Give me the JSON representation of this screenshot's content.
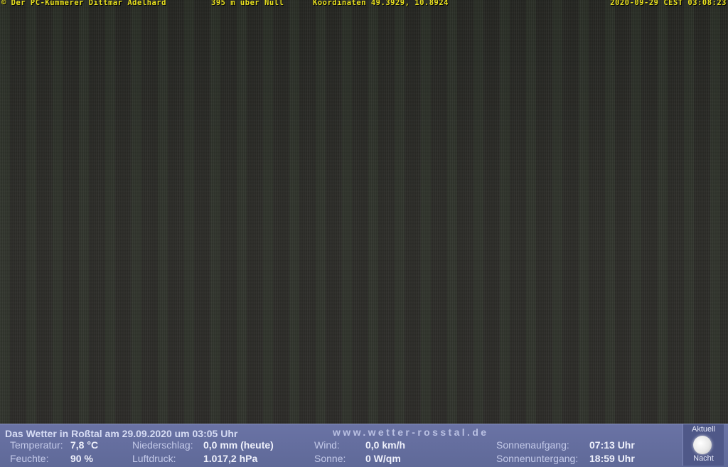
{
  "camera": {
    "copyright": "© Der PC-Kümmerer Dittmar Adelhard",
    "altitude": "395 m über Null",
    "coordinates": "Koordinaten 49.3929, 10.8924",
    "timestamp": "2020-09-29 CEST 03:08:23"
  },
  "weather": {
    "headline": "Das Wetter in Roßtal am 29.09.2020 um 03:05 Uhr",
    "website": "www.wetter-rosstal.de",
    "temperature_label": "Temperatur:",
    "temperature_value": "7,8 °C",
    "humidity_label": "Feuchte:",
    "humidity_value": "90 %",
    "precip_label": "Niederschlag:",
    "precip_value": "0,0 mm (heute)",
    "pressure_label": "Luftdruck:",
    "pressure_value": "1.017,2 hPa",
    "wind_label": "Wind:",
    "wind_value": "0,0 km/h",
    "sun_label": "Sonne:",
    "sun_value": "0 W/qm",
    "sunrise_label": "Sonnenaufgang:",
    "sunrise_value": "07:13 Uhr",
    "sunset_label": "Sonnenuntergang:",
    "sunset_value": "18:59 Uhr"
  },
  "moon": {
    "top_label": "Aktuell",
    "bottom_label": "Nacht",
    "icon": "full-moon-icon"
  }
}
